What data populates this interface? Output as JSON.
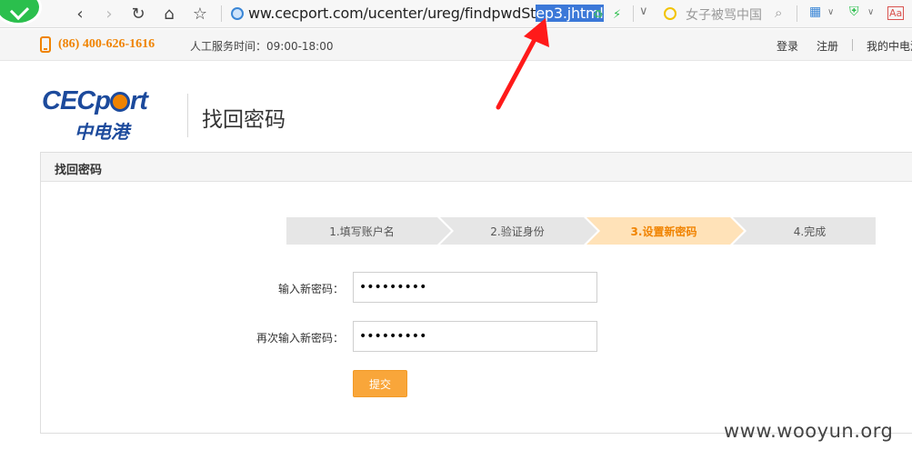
{
  "browser": {
    "url_prefix": "ww.cecport.com/ucenter/ureg/findpwdSt",
    "url_selected": "ep3.jhtml",
    "search_text": "女子被骂中国"
  },
  "topbar": {
    "hotline": "(86) 400-626-1616",
    "service_hours": "人工服务时间：09:00-18:00",
    "login": "登录",
    "register": "注册",
    "my_account": "我的中电港"
  },
  "header": {
    "brand_en": "CECp",
    "brand_en_tail": "rt",
    "brand_cn": "中电港",
    "page_title": "找回密码"
  },
  "panel": {
    "title": "找回密码"
  },
  "steps": [
    {
      "label": "1.填写账户名",
      "active": false
    },
    {
      "label": "2.验证身份",
      "active": false
    },
    {
      "label": "3.设置新密码",
      "active": true
    },
    {
      "label": "4.完成",
      "active": false
    }
  ],
  "form": {
    "new_password_label": "输入新密码：",
    "new_password_value": "•••••••••",
    "confirm_password_label": "再次输入新密码：",
    "confirm_password_value": "•••••••••",
    "submit_label": "提交"
  },
  "watermark": "www.wooyun.org",
  "colors": {
    "accent": "#f08300",
    "brand_blue": "#1c4a9c",
    "active_step_bg": "#ffe2b8",
    "submit_bg": "#f9a63a",
    "annotation_red": "#ff1a1a"
  }
}
